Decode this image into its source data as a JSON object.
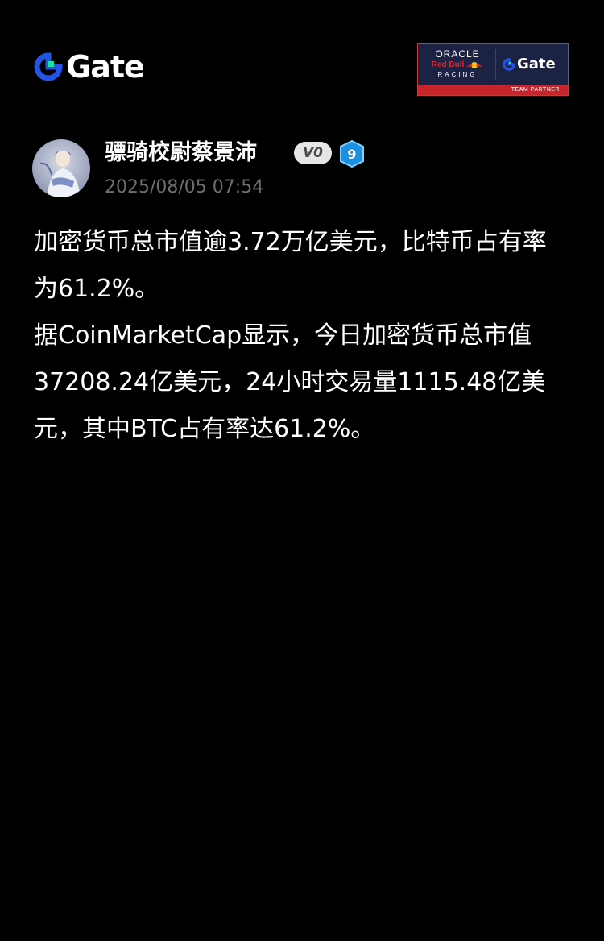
{
  "brand": {
    "name": "Gate",
    "logo_icon": "gate-g-icon",
    "accent_color": "#2354E6",
    "accent_color_2": "#17E6A1"
  },
  "partner_badge": {
    "oracle_text": "ORACLE",
    "redbull_text": "Red Bull",
    "racing_text": "RACING",
    "gate_text": "Gate",
    "strip_text": "TEAM PARTNER",
    "strip_color": "#C8242C",
    "bg_color": "#1B2243"
  },
  "author": {
    "name": "骠骑校尉蔡景沛",
    "vip": "V0",
    "level": "9",
    "avatar_icon": "avatar-illustration"
  },
  "post": {
    "time": "2025/08/05 07:54",
    "paragraphs": [
      "加密货币总市值逾3.72万亿美元，比特币占有率为61.2%。",
      "据CoinMarketCap显示，今日加密货币总市值37208.24亿美元，24小时交易量1115.48亿美元，其中BTC占有率达61.2%。"
    ]
  }
}
